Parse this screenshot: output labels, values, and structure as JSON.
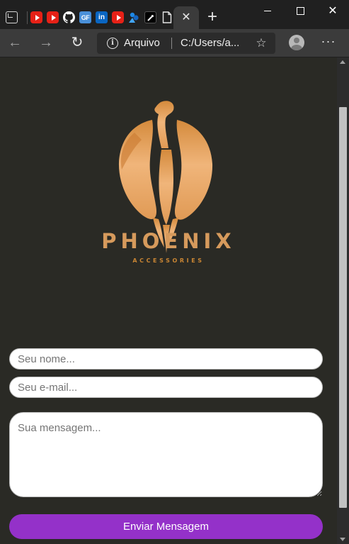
{
  "browser": {
    "tab_close_glyph": "✕",
    "new_tab_glyph": "+",
    "window_close_glyph": "✕",
    "favicons": [
      "youtube-icon",
      "youtube-icon",
      "github-icon",
      "gf-icon",
      "linkedin-icon",
      "youtube-icon",
      "meridio-icon",
      "dark-app-icon",
      "document-icon"
    ],
    "gf_label": "GF",
    "linkedin_label": "in"
  },
  "toolbar": {
    "back_glyph": "←",
    "forward_glyph": "→",
    "refresh_glyph": "↻",
    "scheme_label": "Arquivo",
    "url": "C:/Users/a...",
    "more_glyph": "···"
  },
  "page": {
    "brand": "PHOENIX",
    "tagline": "ACCESSORIES",
    "form": {
      "name_placeholder": "Seu nome...",
      "email_placeholder": "Seu e-mail...",
      "message_placeholder": "Sua mensagem...",
      "submit_label": "Enviar Mensagem"
    }
  },
  "colors": {
    "page_bg": "#2a2a25",
    "logo_gold": "#e6a160",
    "button_purple": "#9431c9"
  }
}
